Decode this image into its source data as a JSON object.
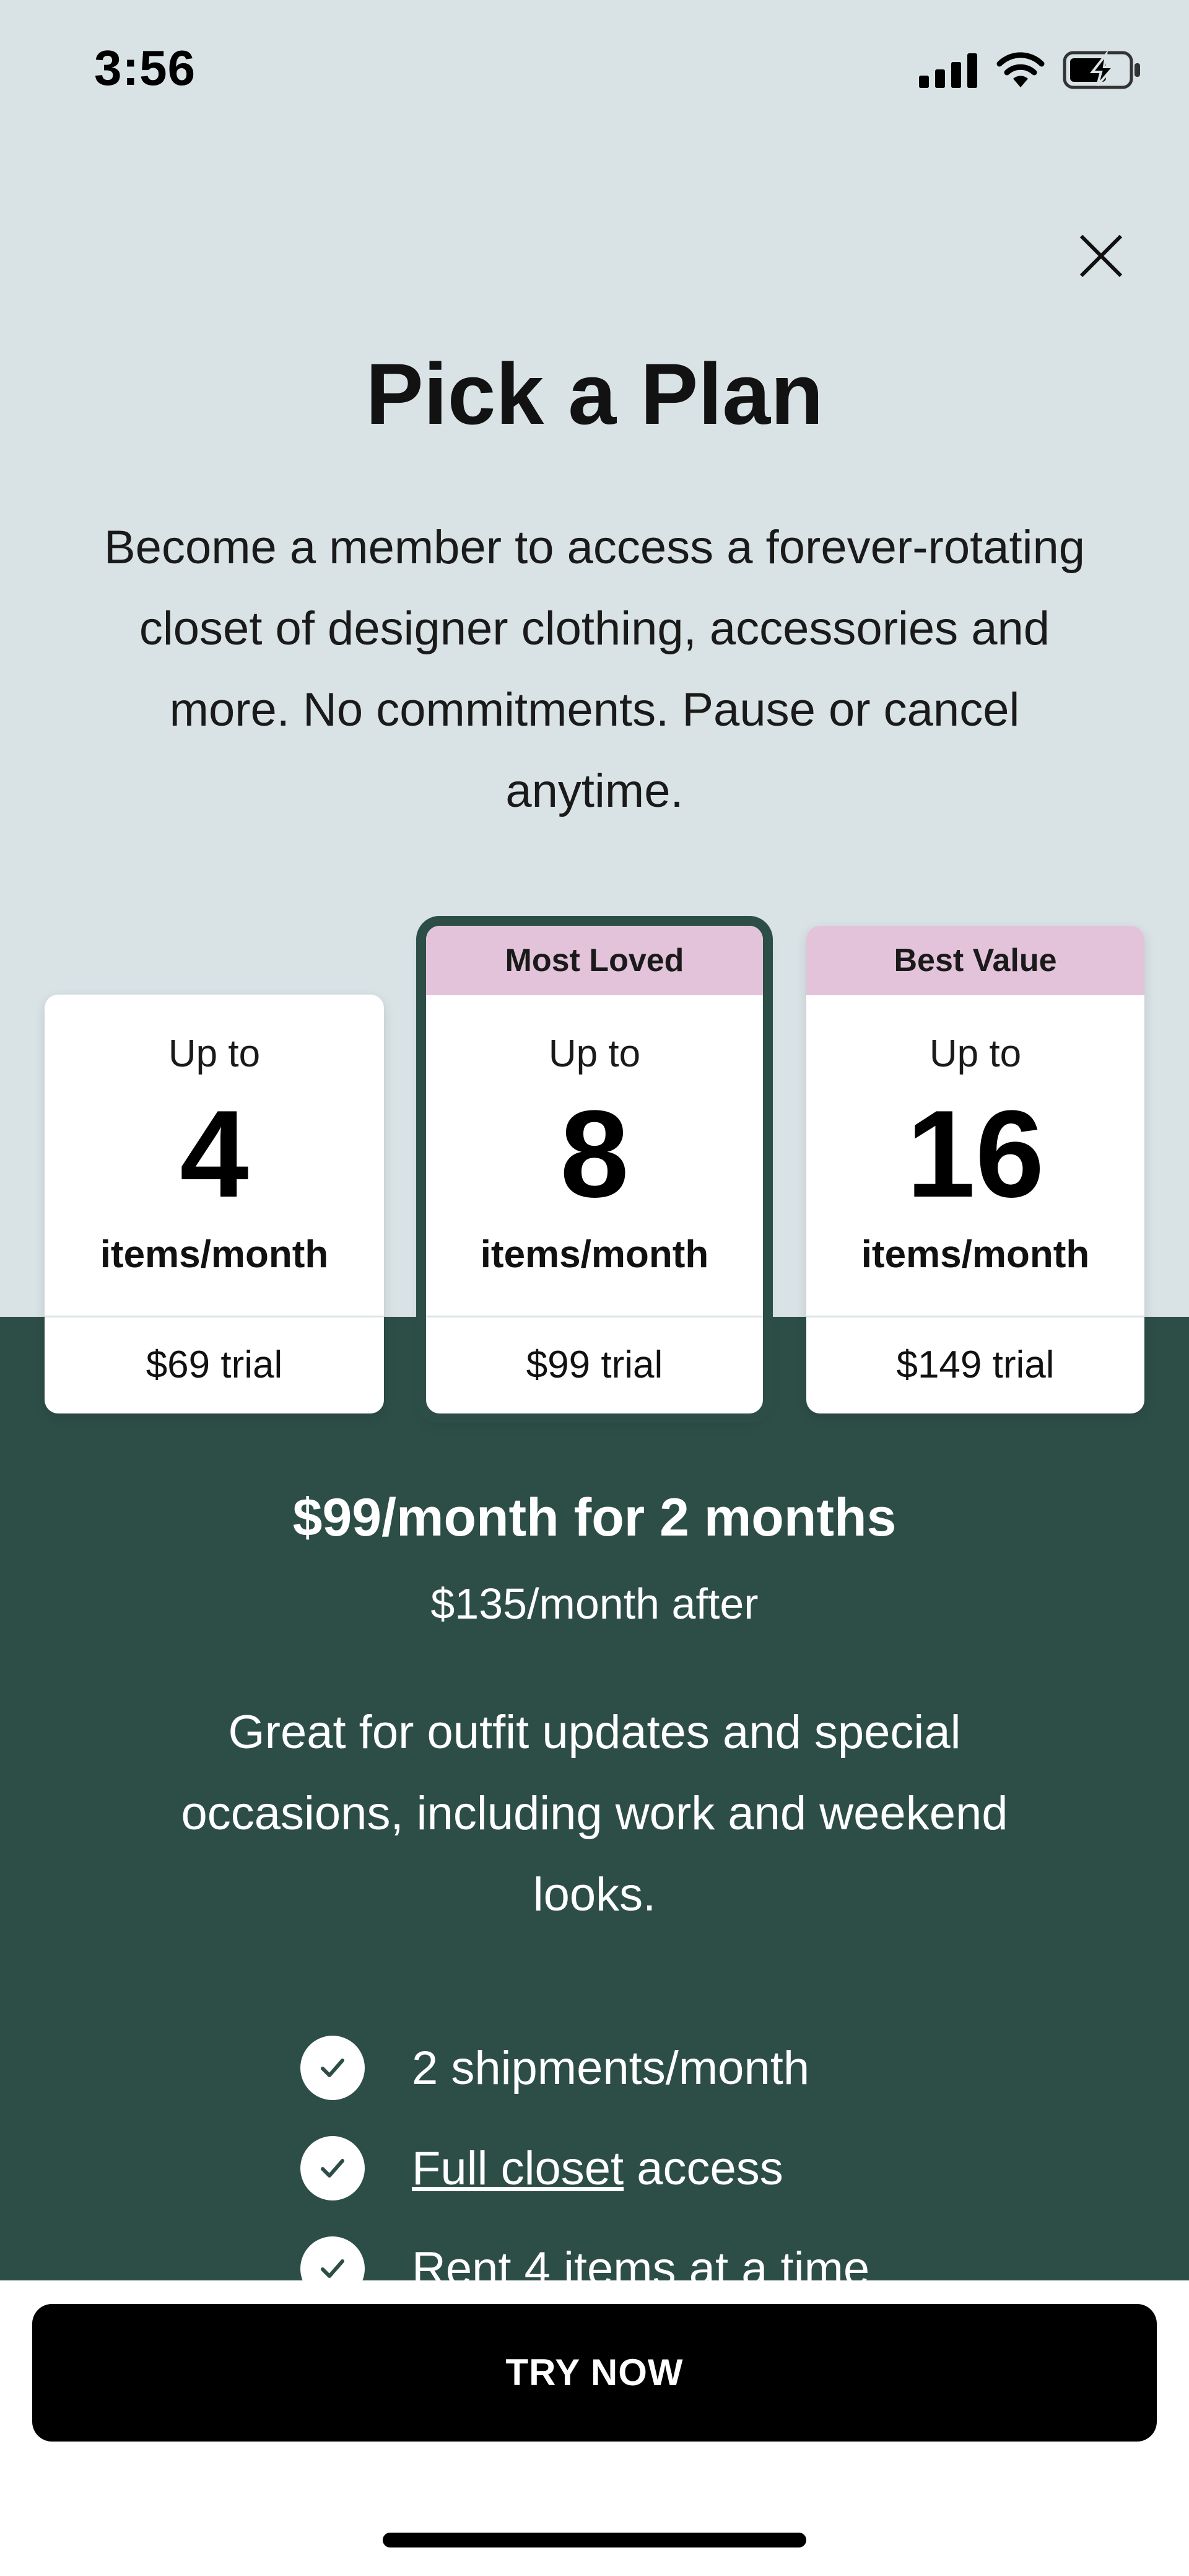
{
  "status_bar": {
    "time": "3:56"
  },
  "header": {
    "title": "Pick a Plan",
    "intro": "Become a member to access a forever-rotating closet of designer clothing, accessories and more. No commitments. Pause or cancel anytime."
  },
  "plans": [
    {
      "badge": "",
      "prefix": "Up to",
      "count": "4",
      "unit": "items/month",
      "price": "$69 trial"
    },
    {
      "badge": "Most Loved",
      "prefix": "Up to",
      "count": "8",
      "unit": "items/month",
      "price": "$99 trial"
    },
    {
      "badge": "Best Value",
      "prefix": "Up to",
      "count": "16",
      "unit": "items/month",
      "price": "$149 trial"
    }
  ],
  "selected_plan": {
    "offer": "$99/month for 2 months",
    "after": "$135/month after",
    "description": "Great for outfit updates and special occasions, including work and weekend looks.",
    "features": [
      {
        "text": "2 shipments/month"
      },
      {
        "link": "Full closet",
        "text": " access"
      },
      {
        "text": "Rent 4 items at a time"
      }
    ]
  },
  "cta": {
    "label": "TRY NOW"
  },
  "colors": {
    "background_top": "#d9e3e6",
    "background_green": "#2d4e47",
    "badge": "#e2c3da",
    "cta": "#000000"
  },
  "icons": {
    "close": "close-icon",
    "check": "check-icon"
  }
}
